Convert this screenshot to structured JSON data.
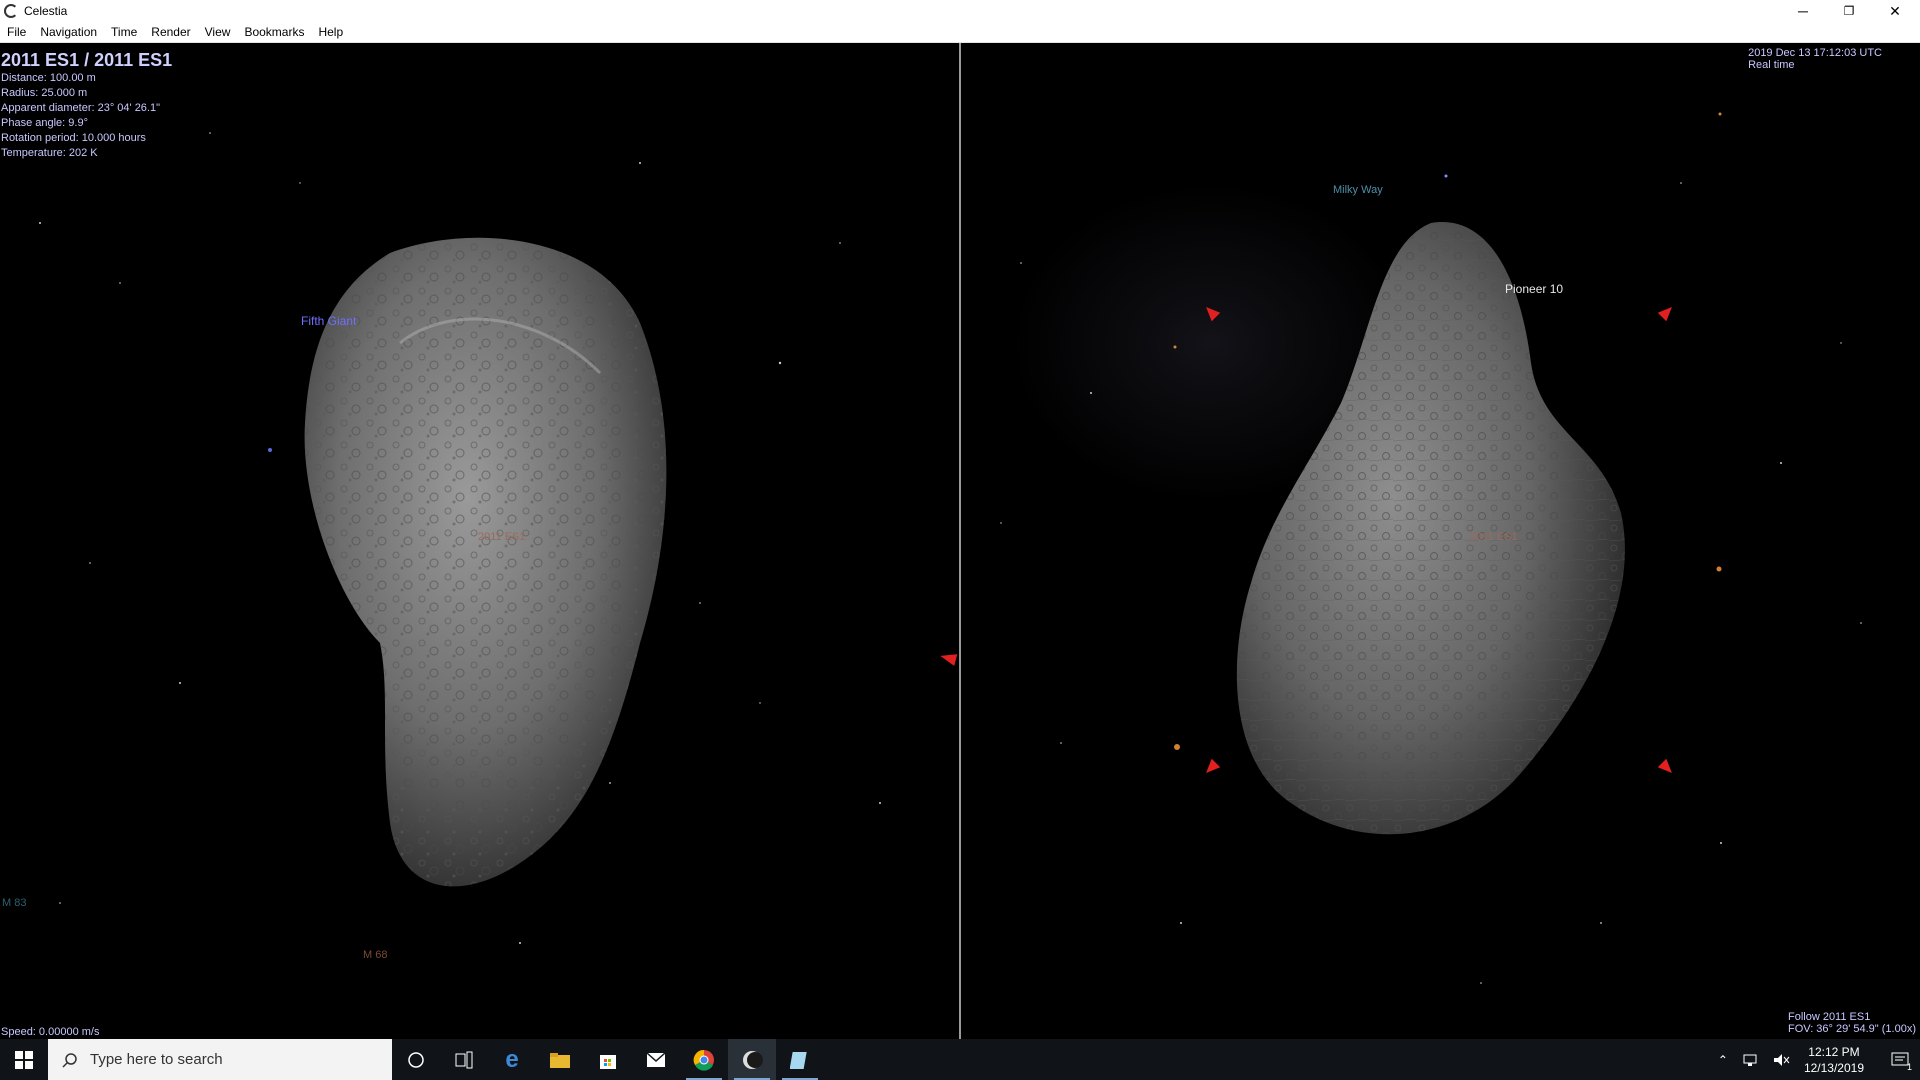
{
  "window": {
    "title": "Celestia",
    "controls": {
      "minimize": "─",
      "restore": "❐",
      "close": "✕"
    }
  },
  "menu": {
    "items": [
      "File",
      "Navigation",
      "Time",
      "Render",
      "View",
      "Bookmarks",
      "Help"
    ]
  },
  "left_view": {
    "object_title": "2011 ES1 / 2011 ES1",
    "info_lines": [
      "Distance: 100.00 m",
      "Radius: 25.000 m",
      "Apparent diameter: 23° 04' 26.1\"",
      "Phase angle: 9.9°",
      "Rotation period: 10.000 hours",
      "Temperature: 202 K"
    ],
    "labels": {
      "fifth_giant": "Fifth Giant",
      "asteroid": "2011 ES1",
      "m83": "M 83",
      "m68": "M 68"
    },
    "speed": "Speed: 0.00000 m/s"
  },
  "right_view": {
    "datetime": "2019 Dec 13 17:12:03 UTC",
    "time_mode": "Real time",
    "labels": {
      "milky_way": "Milky Way",
      "pioneer": "Pioneer 10",
      "asteroid": "2011 ES1"
    },
    "follow": "Follow 2011 ES1",
    "fov": "FOV: 36° 29' 54.9\" (1.00x)"
  },
  "taskbar": {
    "search_placeholder": "Type here to search",
    "icons": [
      "cortana-icon",
      "task-view-icon",
      "edge-icon",
      "file-explorer-icon",
      "store-icon",
      "mail-icon",
      "chrome-icon",
      "celestia-icon",
      "notepad-icon"
    ],
    "clock_time": "12:12 PM",
    "clock_date": "12/13/2019",
    "notification_count": "1"
  },
  "colors": {
    "info_text": "#c8c8ff",
    "label_blue": "#7070ff",
    "label_teal": "#4f8fa8",
    "label_orange": "#c0704f",
    "marker_red": "#e32020",
    "divider": "#9a9a9a"
  }
}
